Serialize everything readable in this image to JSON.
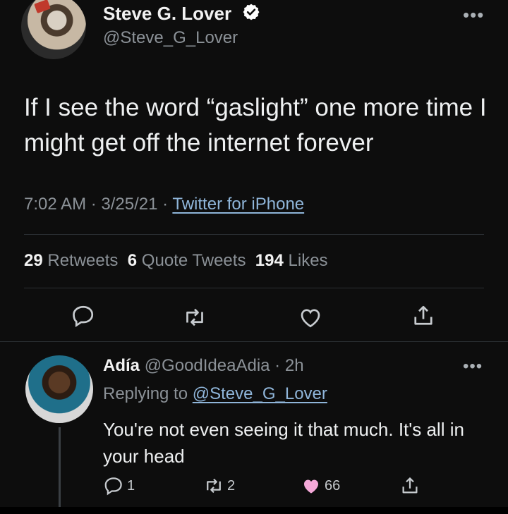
{
  "main_tweet": {
    "display_name": "Steve G. Lover",
    "handle": "@Steve_G_Lover",
    "more": "•••",
    "text": "If I see the word “gaslight” one more time I might get off the internet forever",
    "time": "7:02 AM",
    "date": "3/25/21",
    "source": "Twitter for iPhone",
    "stats": {
      "retweets_count": "29",
      "retweets_label": "Retweets",
      "quotes_count": "6",
      "quotes_label": "Quote Tweets",
      "likes_count": "194",
      "likes_label": "Likes"
    }
  },
  "reply": {
    "display_name": "Adía",
    "handle": "@GoodIdeaAdia",
    "age": "2h",
    "more": "•••",
    "replying_label": "Replying to",
    "replying_to": "@Steve_G_Lover",
    "text": "You're not even seeing it that much. It's all in your head",
    "replies": "1",
    "retweets": "2",
    "likes": "66"
  },
  "colors": {
    "background": "#0d0d0d",
    "accent_link": "#8fb5d9",
    "like_fill": "#f4a8d8",
    "verified": "#ffffff"
  },
  "icons": [
    "verified-badge-icon",
    "reply-icon",
    "retweet-icon",
    "like-icon",
    "share-icon",
    "more-icon"
  ]
}
